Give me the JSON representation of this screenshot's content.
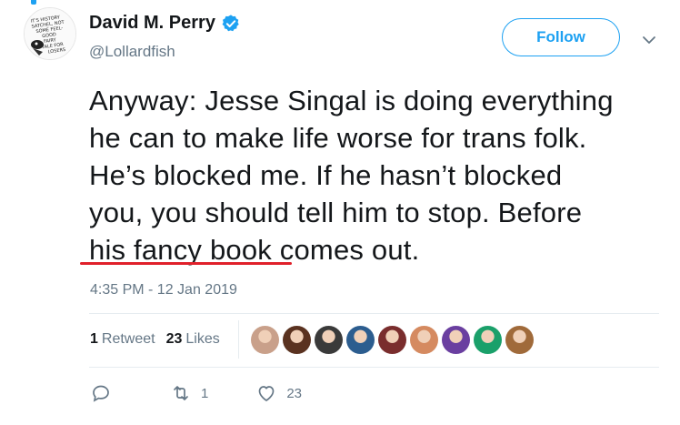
{
  "author": {
    "name": "David M. Perry",
    "handle": "@Lollardfish",
    "verified": true,
    "avatar_icon": "sketch-avatar-icon",
    "avatar_text": "IT'S HISTORY SATCHEL, NOT SOME FEEL-GOOD FAIRY TALE FOR LOSERS"
  },
  "follow_button": {
    "label": "Follow"
  },
  "tweet": {
    "lines": [
      "Anyway: Jesse Singal is doing everything",
      "he can to make life worse for trans folk.",
      "He’s blocked me. If he hasn’t blocked",
      "you, you should tell him to stop. Before",
      "his fancy book comes out."
    ],
    "underlined_phrase": "his fancy book",
    "timestamp": "4:35 PM - 12 Jan 2019"
  },
  "stats": {
    "retweets_count": "1",
    "retweets_label": "Retweet",
    "likes_count": "23",
    "likes_label": "Likes"
  },
  "likers": [
    {
      "icon": "liker-avatar-icon",
      "color": "#c9a08a"
    },
    {
      "icon": "liker-avatar-icon",
      "color": "#5a3220"
    },
    {
      "icon": "liker-avatar-icon",
      "color": "#3a3a3a"
    },
    {
      "icon": "liker-avatar-icon",
      "color": "#2c5d8f"
    },
    {
      "icon": "liker-avatar-icon",
      "color": "#7a2d2d"
    },
    {
      "icon": "liker-avatar-icon",
      "color": "#d58a60"
    },
    {
      "icon": "liker-avatar-icon",
      "color": "#6a3fa0"
    },
    {
      "icon": "liker-avatar-icon",
      "color": "#1aa06a"
    },
    {
      "icon": "liker-avatar-icon",
      "color": "#a06a3a"
    }
  ],
  "actions": {
    "reply_count": "",
    "retweet_count": "1",
    "like_count": "23"
  },
  "colors": {
    "accent": "#1da1f2",
    "muted": "#657786",
    "underline": "#e0202a"
  }
}
